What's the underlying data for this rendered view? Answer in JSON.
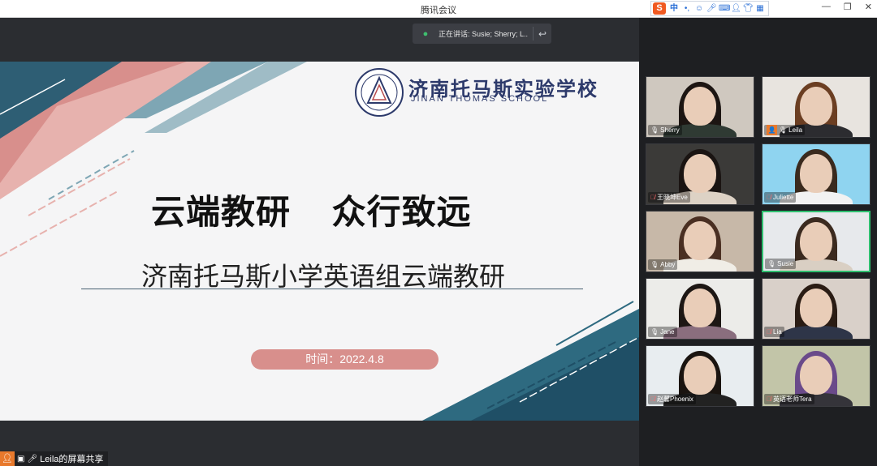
{
  "window": {
    "title": "腾讯会议",
    "ime_label": "中",
    "ime_icons": [
      "dot-icon",
      "smile-icon",
      "mic-icon",
      "keyboard-icon",
      "user-icon",
      "shirt-icon",
      "grid-icon"
    ],
    "controls": [
      "minimize-icon",
      "restore-icon",
      "close-icon"
    ]
  },
  "speaking": {
    "text": "正在讲话: Susie; Sherry; L..."
  },
  "slide": {
    "school_name_cn": "济南托马斯实验学校",
    "school_name_en": "JINAN THOMAS SCHOOL",
    "headline": "云端教研    众行致远",
    "subtitle": "济南托马斯小学英语组云端教研",
    "date_text": "时间：2022.4.8",
    "colors": {
      "pink": "#d88f8c",
      "teal": "#7ea6b4",
      "navy": "#1f4f66",
      "text_blue": "#2d3a6b"
    }
  },
  "share": {
    "label": "Leila的屏幕共享"
  },
  "participants": [
    {
      "name": "Sherry",
      "mic": "on",
      "host": false
    },
    {
      "name": "Leila",
      "mic": "on",
      "host": true
    },
    {
      "name": "王晓坤Eve",
      "mic": "off",
      "host": false
    },
    {
      "name": "Juliette",
      "mic": "off",
      "host": false
    },
    {
      "name": "Abby",
      "mic": "on",
      "host": false
    },
    {
      "name": "Susie",
      "mic": "on",
      "host": false,
      "active": true
    },
    {
      "name": "Jane",
      "mic": "on",
      "host": false
    },
    {
      "name": "Lia",
      "mic": "off",
      "host": false
    },
    {
      "name": "赵馨Phoenix",
      "mic": "off",
      "host": false
    },
    {
      "name": "英语老师Tera",
      "mic": "off",
      "host": false
    }
  ]
}
